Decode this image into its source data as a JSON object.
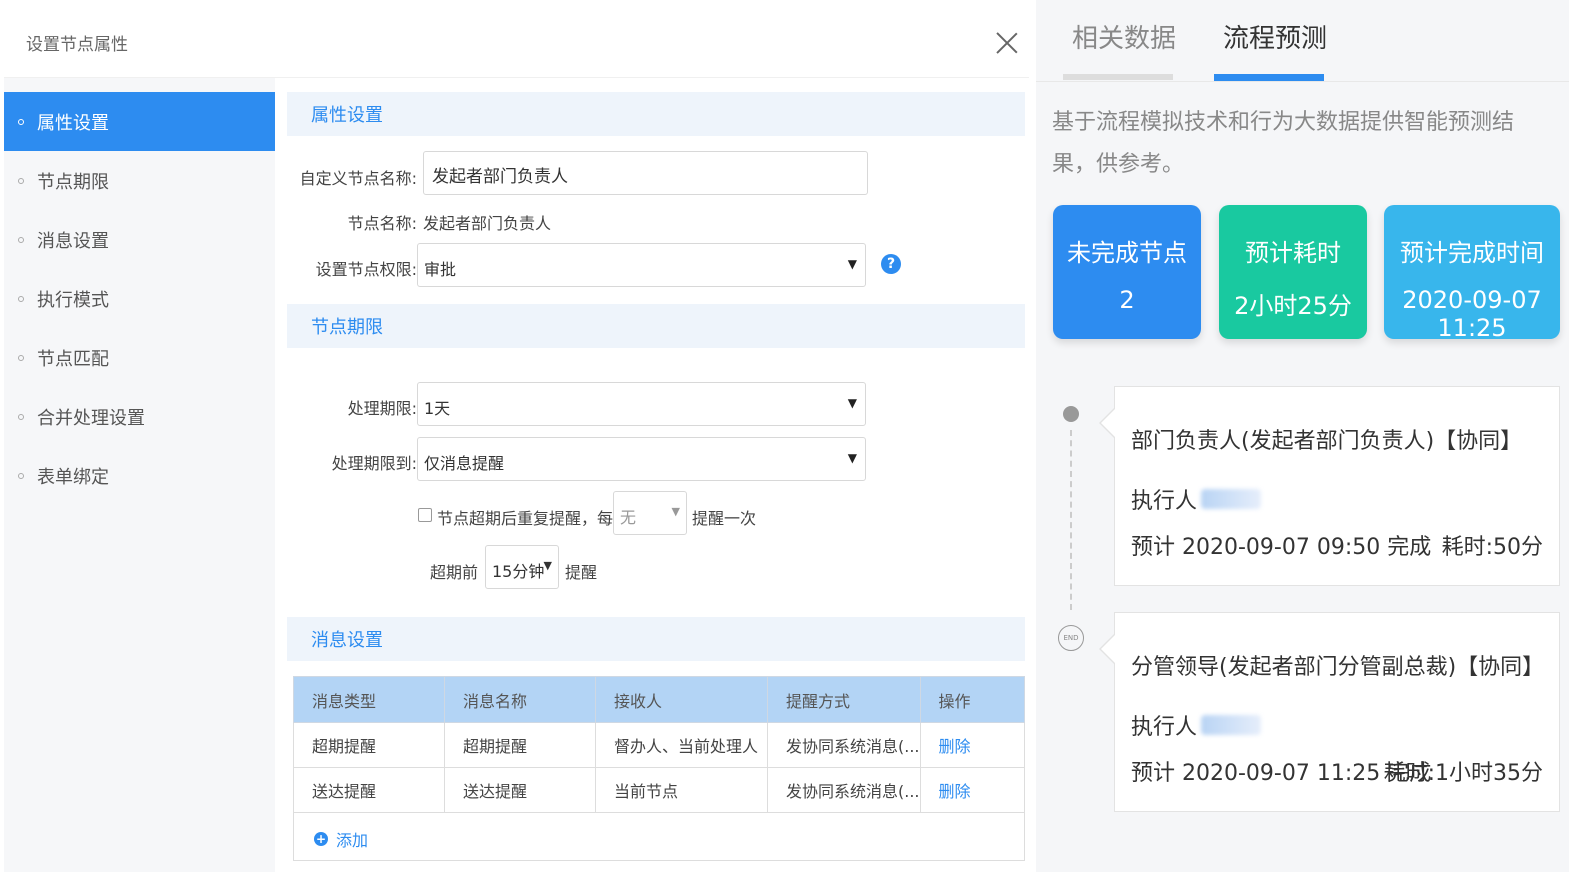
{
  "dialog": {
    "title": "设置节点属性"
  },
  "sidebar": {
    "items": [
      {
        "label": "属性设置",
        "active": true
      },
      {
        "label": "节点期限"
      },
      {
        "label": "消息设置"
      },
      {
        "label": "执行模式"
      },
      {
        "label": "节点匹配"
      },
      {
        "label": "合并处理设置"
      },
      {
        "label": "表单绑定"
      }
    ]
  },
  "attr_section": {
    "title": "属性设置",
    "custom_name_label": "自定义节点名称:",
    "custom_name_value": "发起者部门负责人",
    "node_name_label": "节点名称:",
    "node_name_value": "发起者部门负责人",
    "permission_label": "设置节点权限:",
    "permission_value": "审批"
  },
  "deadline_section": {
    "title": "节点期限",
    "period_label": "处理期限:",
    "period_value": "1天",
    "period_to_label": "处理期限到:",
    "period_to_value": "仅消息提醒",
    "repeat_label": "节点超期后重复提醒，每",
    "repeat_select": "无",
    "repeat_suffix": "提醒一次",
    "before_label": "超期前",
    "before_value": "15分钟",
    "before_suffix": "提醒"
  },
  "message_section": {
    "title": "消息设置",
    "columns": [
      "消息类型",
      "消息名称",
      "接收人",
      "提醒方式",
      "操作"
    ],
    "rows": [
      [
        "超期提醒",
        "超期提醒",
        "督办人、当前处理人",
        "发协同系统消息(...",
        "删除"
      ],
      [
        "送达提醒",
        "送达提醒",
        "当前节点",
        "发协同系统消息(...",
        "删除"
      ]
    ],
    "add_label": "添加"
  },
  "right_panel": {
    "tabs": [
      "相关数据",
      "流程预测"
    ],
    "active_tab": "流程预测",
    "description": "基于流程模拟技术和行为大数据提供智能预测结果，供参考。",
    "cards": [
      {
        "title": "未完成节点",
        "value": "2",
        "color": "#2d8cf0"
      },
      {
        "title": "预计耗时",
        "value": "2小时25分",
        "color": "#19c9a0"
      },
      {
        "title": "预计完成时间",
        "value": "2020-09-07 11:25",
        "color": "#38b6ec"
      }
    ],
    "timeline": [
      {
        "title": "部门负责人(发起者部门负责人)【协同】",
        "executor_label": "执行人",
        "estimate": "预计 2020-09-07 09:50 完成",
        "cost": "耗时:50分"
      },
      {
        "title": "分管领导(发起者部门分管副总裁)【协同】",
        "executor_label": "执行人",
        "estimate": "预计 2020-09-07 11:25 完成",
        "cost": "耗时:1小时35分"
      }
    ],
    "end_label": "END"
  },
  "icons": {
    "close": "close-icon",
    "help": "help-icon",
    "plus": "plus-circle-icon",
    "dropdown": "chevron-down-icon"
  },
  "colors": {
    "accent": "#2d8cf0",
    "section_bg": "#eef4fb",
    "table_header": "#b3d4f5"
  }
}
